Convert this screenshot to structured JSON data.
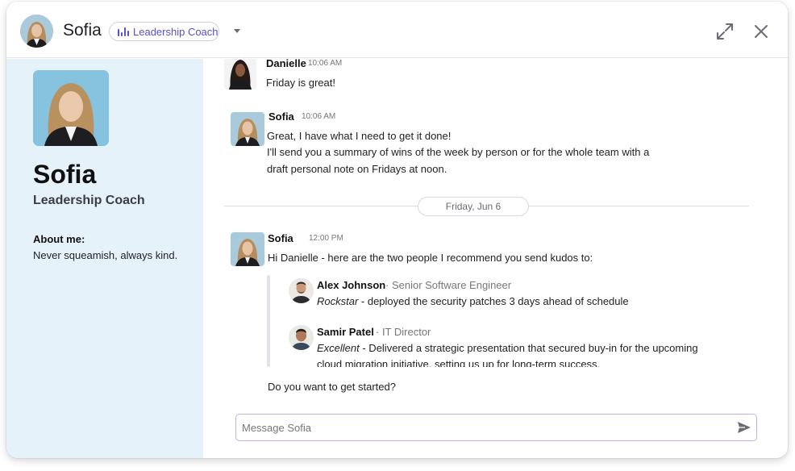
{
  "header": {
    "name": "Sofia",
    "role_pill": "Leadership Coach"
  },
  "sidebar": {
    "name": "Sofia",
    "role": "Leadership Coach",
    "about_label": "About me:",
    "about_text": "Never squeamish, always kind."
  },
  "messages": [
    {
      "author": "Danielle",
      "time": "10:06 AM",
      "lines": [
        "Friday is great!"
      ]
    },
    {
      "author": "Sofia",
      "time": "10:06 AM",
      "lines": [
        "Great, I have what I need to get it done!",
        "I'll send you a summary of wins of the week by person or for the whole team with a",
        "draft personal note on Fridays at noon."
      ]
    },
    {
      "author": "Sofia",
      "time": "12:00 PM",
      "lines": [
        "Hi Danielle - here are the two people I recommend you send kudos to:"
      ]
    }
  ],
  "date_divider": "Friday, Jun 6",
  "kudos": [
    {
      "name": "Alex Johnson",
      "title": "· Senior Software Engineer",
      "tag": "Rockstar",
      "text": " - deployed the security patches 3 days ahead of schedule",
      "text2": ""
    },
    {
      "name": "Samir Patel",
      "title": "· IT Director",
      "tag": "Excellent",
      "text": " - Delivered a strategic presentation that secured buy-in for the upcoming",
      "text2": "cloud migration initiative, setting us up for long-term success."
    }
  ],
  "followup": "Do you want to get started?",
  "composer": {
    "placeholder": "Message Sofia"
  },
  "colors": {
    "accent": "#5a4fcf",
    "sidebar_bg": "#e5f2fa"
  },
  "icons": {
    "expand": "expand-icon",
    "close": "close-icon",
    "send": "send-icon",
    "dropdown": "chevron-down-icon",
    "coach": "bars-icon"
  }
}
